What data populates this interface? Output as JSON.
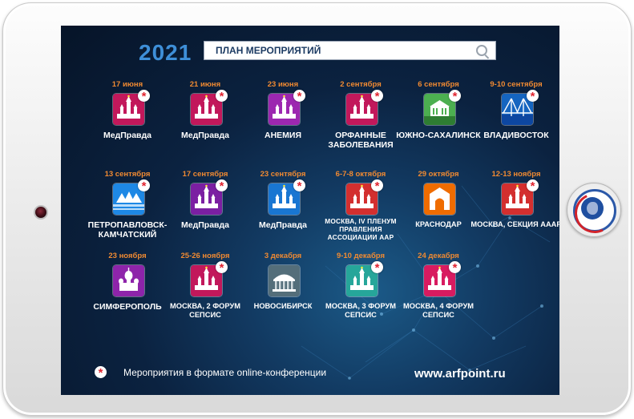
{
  "header": {
    "year": "2021",
    "search_title": "ПЛАН МЕРОПРИЯТИЙ",
    "search_icon": "search-icon"
  },
  "colors": {
    "date": "#f08a32",
    "year": "#3e8fd8",
    "badge_star": "#e0242f"
  },
  "events": [
    {
      "date": "17 июня",
      "label": "МедПравда",
      "icon": "kremlin-icon",
      "color": "#c2185b",
      "online": true
    },
    {
      "date": "21 июня",
      "label": "МедПравда",
      "icon": "kremlin-icon",
      "color": "#c2185b",
      "online": true
    },
    {
      "date": "23 июня",
      "label": "АНЕМИЯ",
      "icon": "kremlin-icon",
      "color": "#9c27b0",
      "online": true
    },
    {
      "date": "2 сентября",
      "label": "ОРФАННЫЕ ЗАБОЛЕВАНИЯ",
      "icon": "kremlin-icon",
      "color": "#c2185b",
      "online": true
    },
    {
      "date": "6 сентября",
      "label": "ЮЖНО-САХАЛИНСК",
      "icon": "building-icon",
      "color": "#4caf50",
      "online": true
    },
    {
      "date": "9-10 сентября",
      "label": "ВЛАДИВОСТОК",
      "icon": "bridge-icon",
      "color": "#1565c0",
      "online": true
    },
    {
      "date": "13 сентября",
      "label": "ПЕТРОПАВЛОВСК-КАМЧАТСКИЙ",
      "icon": "volcano-icon",
      "color": "#1e88e5",
      "online": true
    },
    {
      "date": "17 сентября",
      "label": "МедПравда",
      "icon": "kremlin-icon",
      "color": "#7b1fa2",
      "online": true
    },
    {
      "date": "23 сентября",
      "label": "МедПравда",
      "icon": "kremlin-icon",
      "color": "#1976d2",
      "online": true
    },
    {
      "date": "6-7-8  октября",
      "label": "МОСКВА, IV ПЛЕНУМ ПРАВЛЕНИЯ АССОЦИАЦИИ ААР",
      "icon": "kremlin-icon",
      "color": "#d32f2f",
      "online": true
    },
    {
      "date": "29 октября",
      "label": "КРАСНОДАР",
      "icon": "arch-icon",
      "color": "#ef6c00",
      "online": false
    },
    {
      "date": "12-13 ноября",
      "label": "МОСКВА, СЕКЦИЯ АААР",
      "icon": "kremlin-icon",
      "color": "#d32f2f",
      "online": true
    },
    {
      "date": "23 ноября",
      "label": "СИМФЕРОПОЛЬ",
      "icon": "cathedral-icon",
      "color": "#8e24aa",
      "online": false
    },
    {
      "date": "25-26 ноября",
      "label": "МОСКВА, 2 ФОРУМ СЕПСИС",
      "icon": "kremlin-icon",
      "color": "#c2185b",
      "online": true
    },
    {
      "date": "3 декабря",
      "label": "НОВОСИБИРСК",
      "icon": "theater-icon",
      "color": "#546e7a",
      "online": false
    },
    {
      "date": "9-10 декабря",
      "label": "МОСКВА, 3 ФОРУМ СЕПСИС",
      "icon": "kremlin-icon",
      "color": "#26a69a",
      "online": true
    },
    {
      "date": "24 декабря",
      "label": "МОСКВА, 4 ФОРУМ СЕПСИС",
      "icon": "kremlin-icon",
      "color": "#d81b60",
      "online": true
    }
  ],
  "legend": {
    "star": "*",
    "text": "Мероприятия в формате online-конференции"
  },
  "footer": {
    "site": "www.arfpoint.ru"
  },
  "badge_star": "*"
}
